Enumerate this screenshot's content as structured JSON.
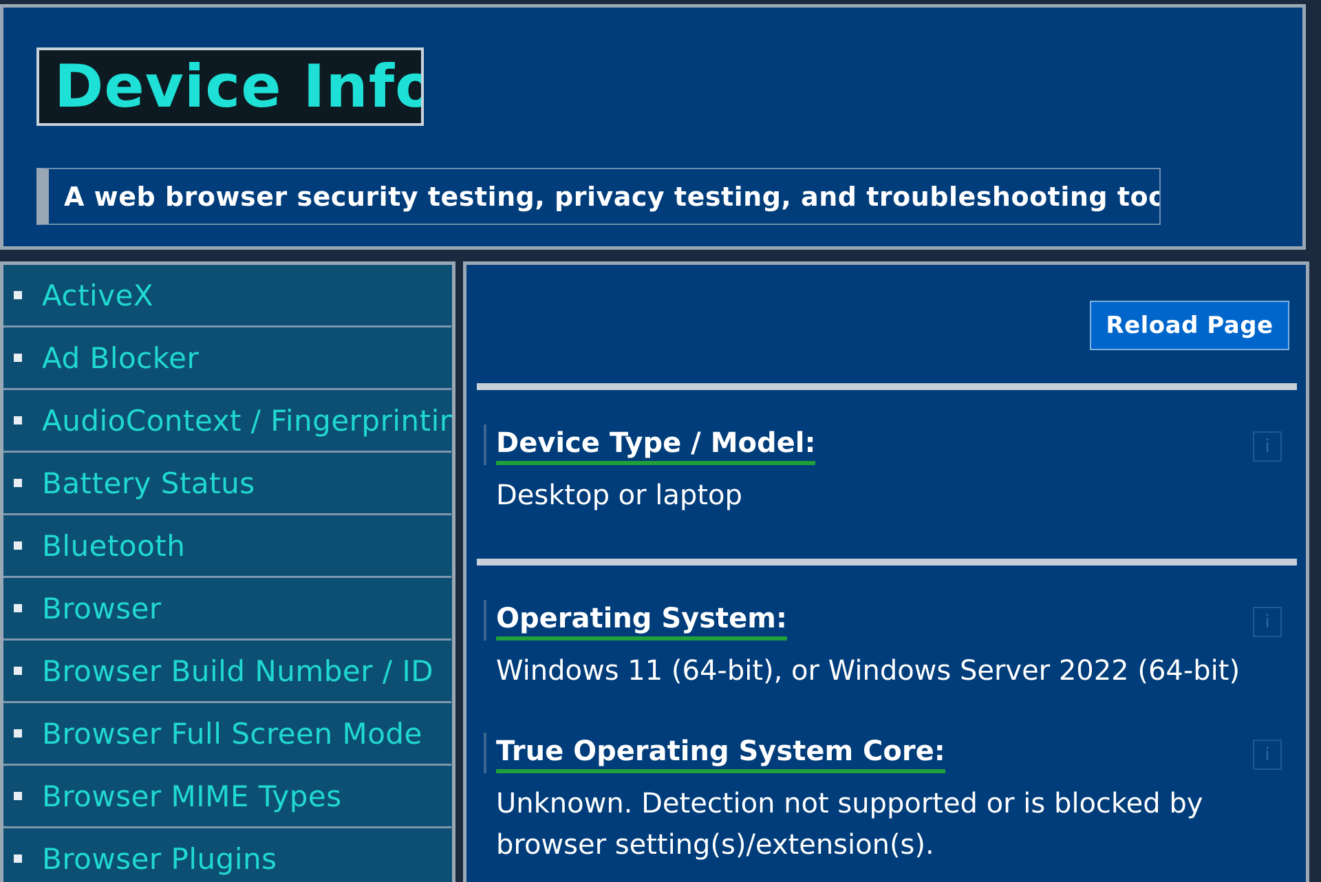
{
  "header": {
    "logo_text": "Device Info",
    "tagline": "A web browser security testing, privacy testing, and troubleshooting tool."
  },
  "sidebar": {
    "items": [
      {
        "label": "ActiveX"
      },
      {
        "label": "Ad Blocker"
      },
      {
        "label": "AudioContext / Fingerprinting"
      },
      {
        "label": "Battery Status"
      },
      {
        "label": "Bluetooth"
      },
      {
        "label": "Browser"
      },
      {
        "label": "Browser Build Number / ID"
      },
      {
        "label": "Browser Full Screen Mode"
      },
      {
        "label": "Browser MIME Types"
      },
      {
        "label": "Browser Plugins"
      }
    ]
  },
  "main": {
    "reload_label": "Reload Page",
    "info_icon": "i",
    "sections": [
      {
        "heading": "Device Type / Model:",
        "value": "Desktop or laptop"
      },
      {
        "heading": "Operating System:",
        "value": "Windows 11 (64-bit), or Windows Server 2022 (64-bit)"
      },
      {
        "heading": "True Operating System Core:",
        "value": "Unknown. Detection not supported or is blocked by browser setting(s)/extension(s)."
      }
    ]
  },
  "colors": {
    "background": "#003d7a",
    "sidebar": "#0d4f73",
    "link": "#20d9d0",
    "heading_underline": "#1fa03a",
    "button": "#0066cc"
  }
}
